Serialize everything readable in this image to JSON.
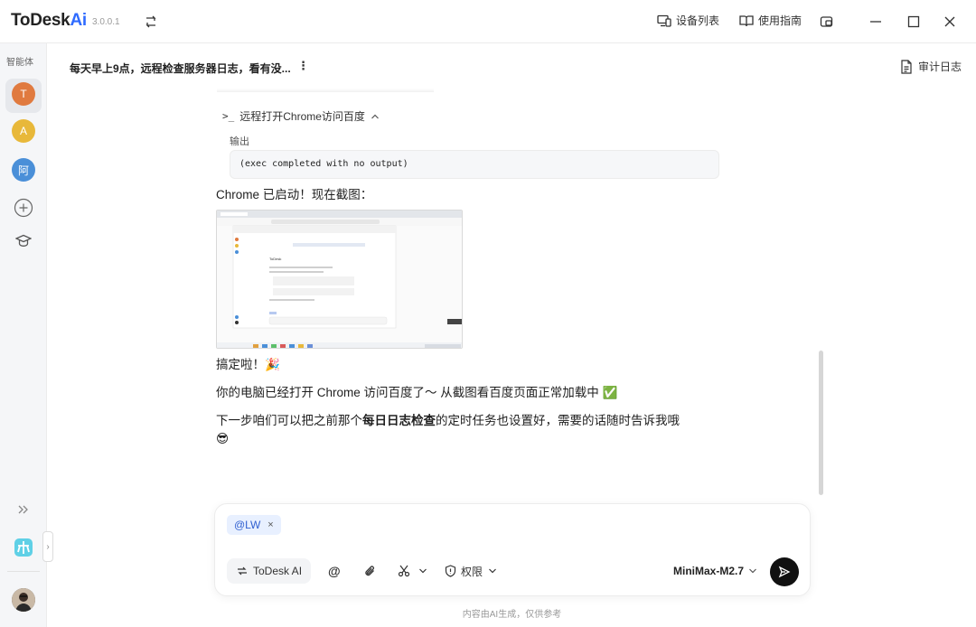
{
  "app": {
    "name_main": "ToDesk",
    "name_accent": "Ai",
    "version": "3.0.0.1"
  },
  "topbar": {
    "devices_label": "设备列表",
    "guide_label": "使用指南"
  },
  "sidebar": {
    "section_label": "智能体",
    "agents": [
      {
        "initial": "T",
        "color": "#e07a3f"
      },
      {
        "initial": "A",
        "color": "#e8b83a"
      },
      {
        "initial": "阿",
        "color": "#4a8fd8"
      }
    ]
  },
  "chat": {
    "title": "每天早上9点，远程检查服务器日志，看有没...",
    "audit_label": "审计日志",
    "command_label": "远程打开Chrome访问百度",
    "output_label": "输出",
    "output_text": "(exec completed with no output)",
    "msg1": "Chrome 已启动！现在截图：",
    "msg2": "搞定啦！🎉",
    "msg3": "你的电脑已经打开 Chrome 访问百度了～ 从截图看百度页面正常加载中 ✅",
    "msg4_pre": "下一步咱们可以把之前那个",
    "msg4_bold": "每日日志检查",
    "msg4_post": "的定时任务也设置好，需要的话随时告诉我哦",
    "msg4_emoji": "😎",
    "screenshot_heading": "ToDesk"
  },
  "composer": {
    "mention": "@LW",
    "mention_remove": "×",
    "agent_pill": "ToDesk AI",
    "permission_label": "权限",
    "model": "MiniMax-M2.7"
  },
  "footer": {
    "note": "内容由AI生成，仅供参考"
  }
}
